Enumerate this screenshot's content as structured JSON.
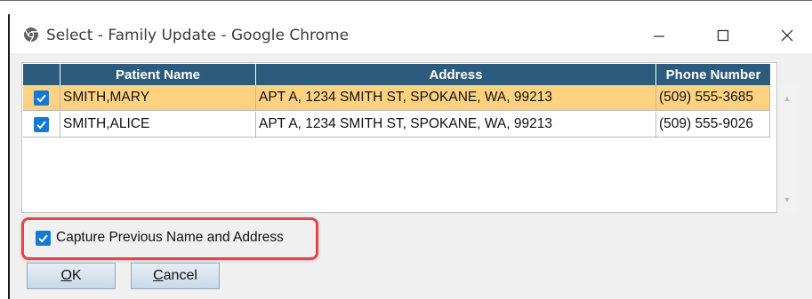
{
  "window": {
    "title": "Select - Family Update - Google Chrome",
    "controls": {
      "minimize": "—",
      "maximize": "☐",
      "close": "✕"
    }
  },
  "grid": {
    "columns": [
      "",
      "Patient Name",
      "Address",
      "Phone Number"
    ],
    "rows": [
      {
        "checked": true,
        "name": "SMITH,MARY",
        "address": "APT A, 1234 SMITH ST, SPOKANE, WA, 99213",
        "phone": "(509) 555-3685",
        "selected": true
      },
      {
        "checked": true,
        "name": "SMITH,ALICE",
        "address": "APT A, 1234 SMITH ST, SPOKANE, WA, 99213",
        "phone": "(509) 555-9026",
        "selected": false
      }
    ]
  },
  "options": {
    "capture_previous": {
      "label": "Capture Previous Name and Address",
      "checked": true
    }
  },
  "buttons": {
    "ok": {
      "mnemonic": "O",
      "rest": "K"
    },
    "cancel": {
      "mnemonic": "C",
      "rest": "ancel"
    }
  },
  "colors": {
    "header_bg": "#2c5c7d",
    "selected_row_bg": "#ffd281",
    "checkbox_blue": "#1479d6",
    "highlight_red": "#e04848"
  }
}
